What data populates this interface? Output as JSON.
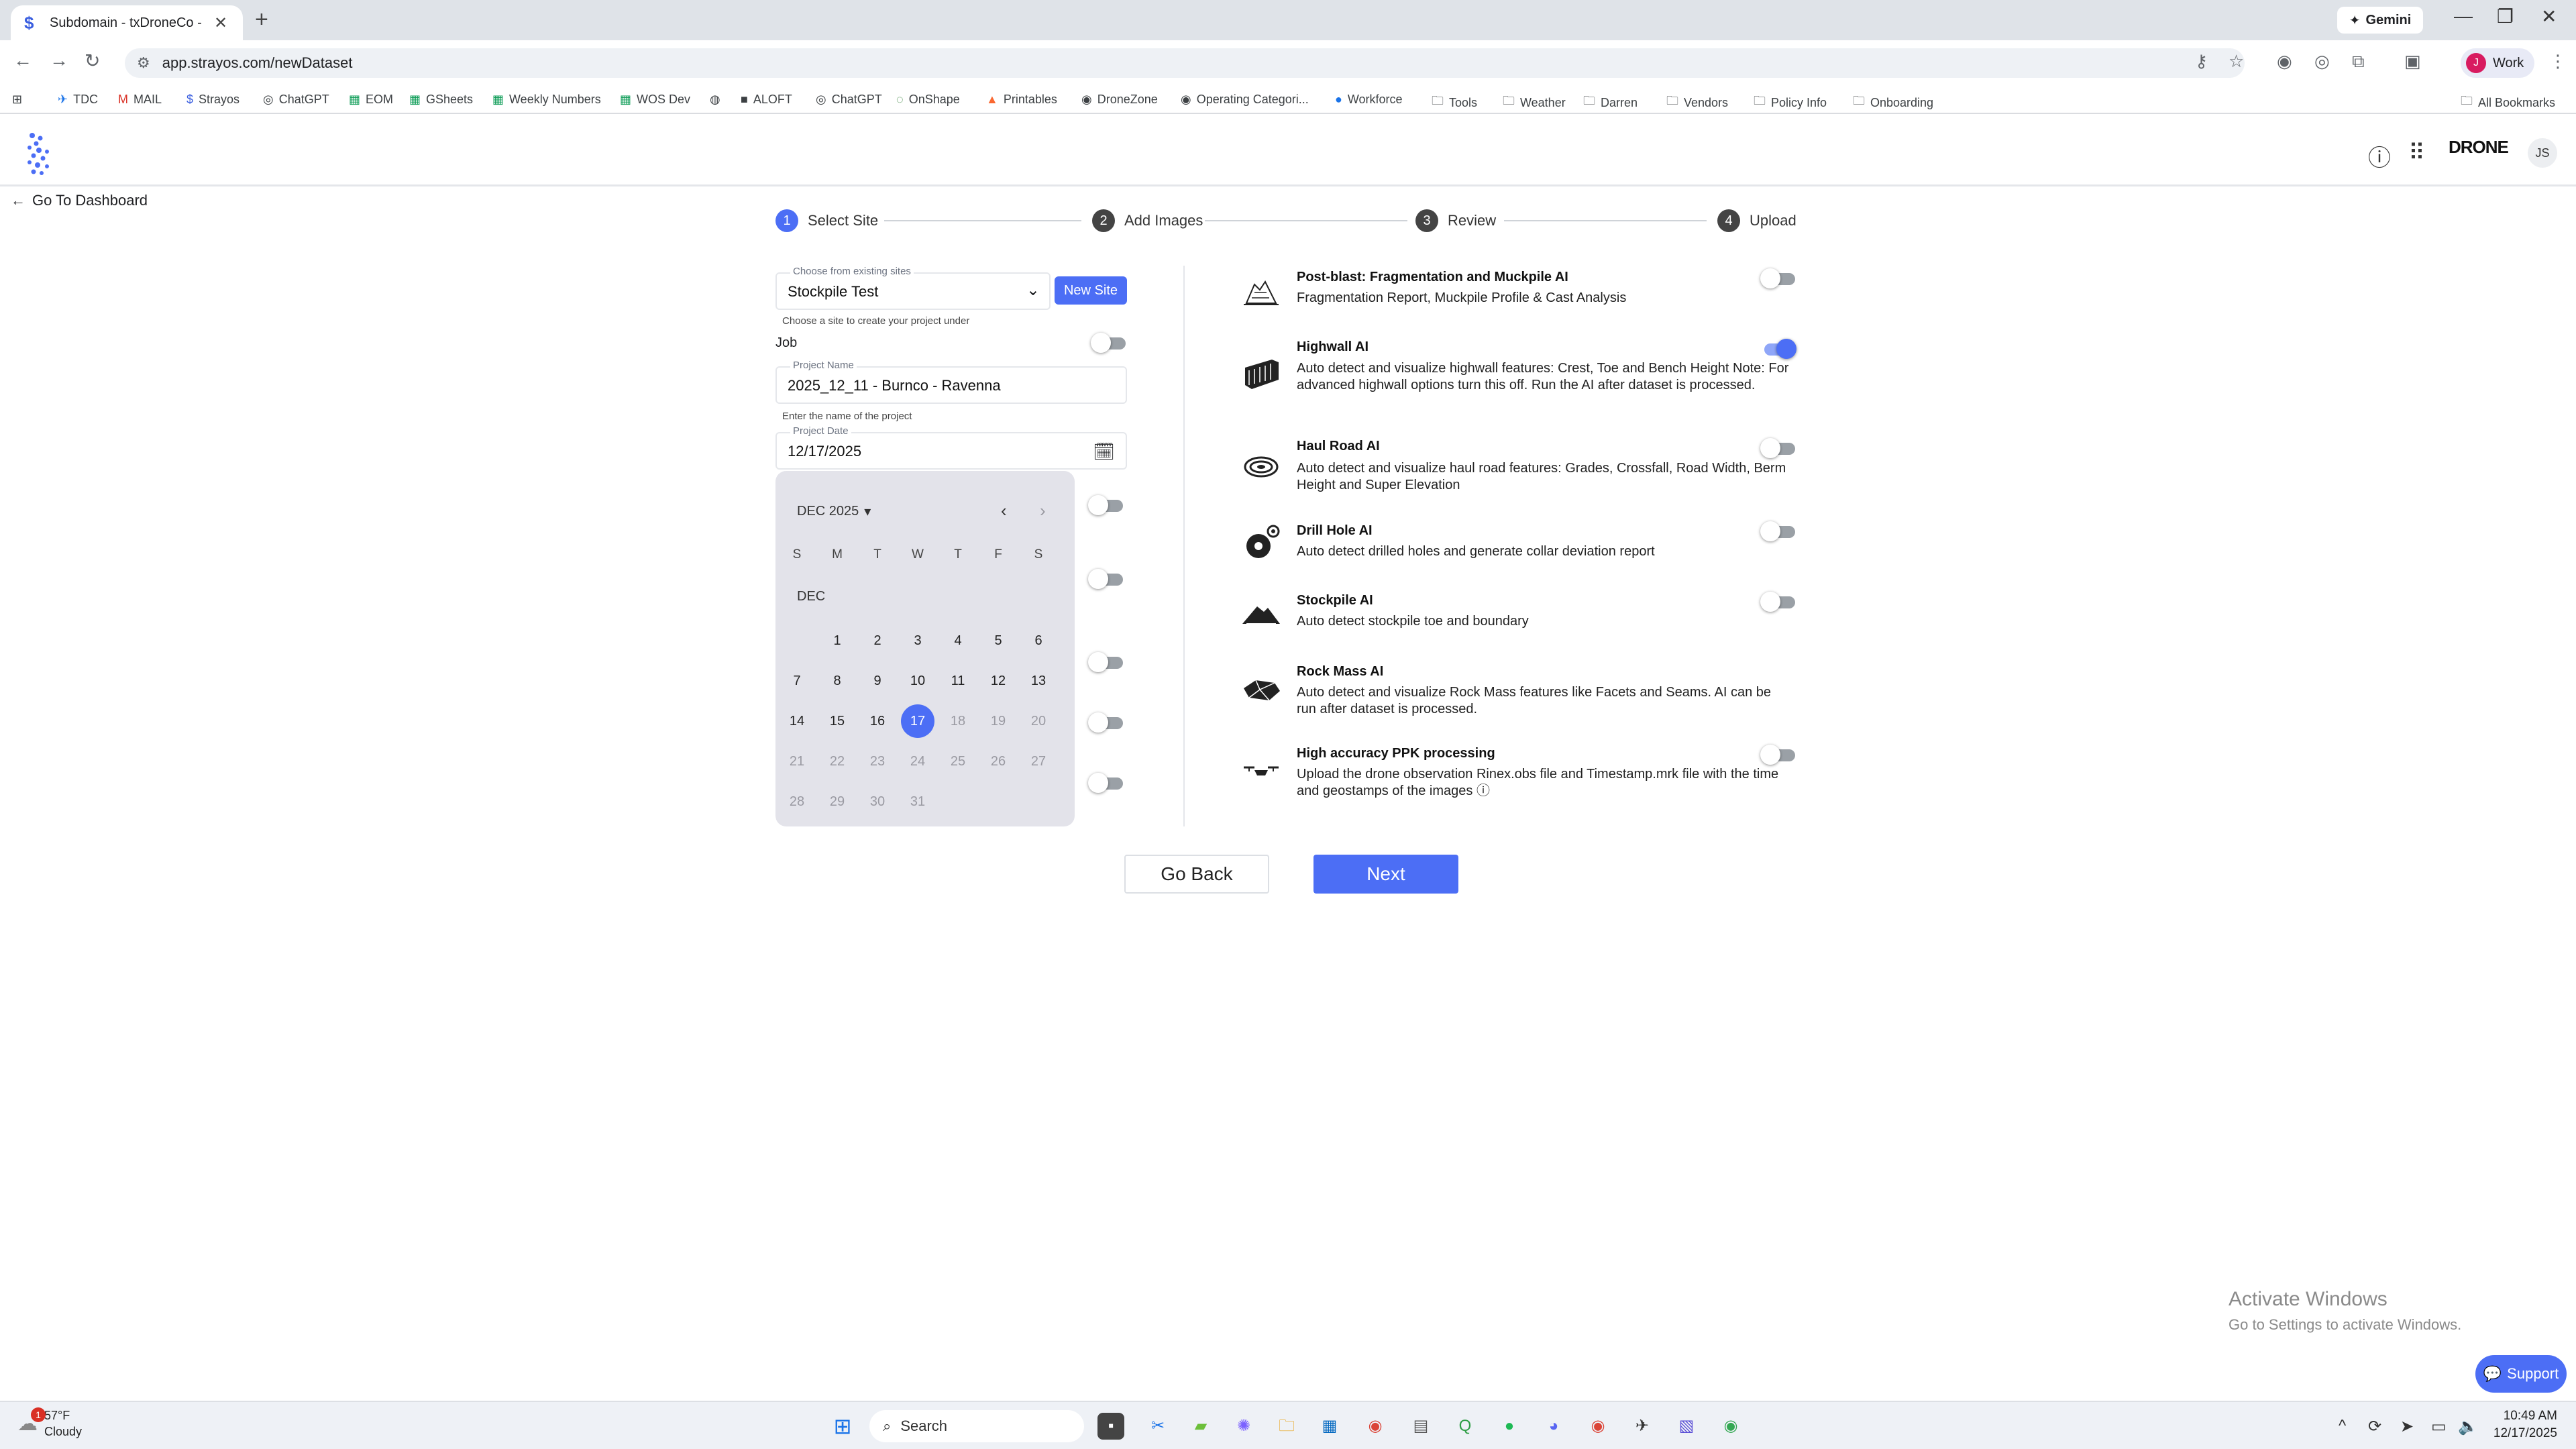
{
  "browser": {
    "tab_title": "Subdomain - txDroneCo - Dem",
    "gemini_label": "Gemini",
    "url": "app.strayos.com/newDataset",
    "profile_label": "Work",
    "profile_initial": "J",
    "bookmarks": [
      {
        "label": "TDC",
        "icon": "tdc-icon"
      },
      {
        "label": "MAIL",
        "icon": "gmail-icon"
      },
      {
        "label": "Strayos",
        "icon": "strayos-icon"
      },
      {
        "label": "ChatGPT",
        "icon": "chatgpt-icon"
      },
      {
        "label": "EOM",
        "icon": "sheets-icon"
      },
      {
        "label": "GSheets",
        "icon": "sheets-icon"
      },
      {
        "label": "Weekly Numbers",
        "icon": "sheets-icon"
      },
      {
        "label": "WOS Dev",
        "icon": "sheets-icon"
      },
      {
        "label": "",
        "icon": "globe-icon"
      },
      {
        "label": "ALOFT",
        "icon": "aloft-icon"
      },
      {
        "label": "ChatGPT",
        "icon": "chatgpt-icon"
      },
      {
        "label": "OnShape",
        "icon": "onshape-icon"
      },
      {
        "label": "Printables",
        "icon": "printables-icon"
      },
      {
        "label": "DroneZone",
        "icon": "dronezone-icon"
      },
      {
        "label": "Operating Categori...",
        "icon": "dronezone-icon"
      },
      {
        "label": "Workforce",
        "icon": "workforce-icon"
      },
      {
        "label": "Tools",
        "icon": "folder-icon"
      },
      {
        "label": "Weather",
        "icon": "folder-icon"
      },
      {
        "label": "Darren",
        "icon": "folder-icon"
      },
      {
        "label": "Vendors",
        "icon": "folder-icon"
      },
      {
        "label": "Policy Info",
        "icon": "folder-icon"
      },
      {
        "label": "Onboarding",
        "icon": "folder-icon"
      }
    ],
    "all_bookmarks": "All Bookmarks"
  },
  "header": {
    "brand_badge": "DRONE",
    "user_initials": "JS"
  },
  "nav": {
    "back_to_dashboard": "Go To Dashboard"
  },
  "stepper": [
    {
      "num": "1",
      "label": "Select Site",
      "active": true
    },
    {
      "num": "2",
      "label": "Add Images",
      "active": false
    },
    {
      "num": "3",
      "label": "Review",
      "active": false
    },
    {
      "num": "4",
      "label": "Upload",
      "active": false
    }
  ],
  "form": {
    "site_label": "Choose from existing sites",
    "site_value": "Stockpile Test",
    "new_site_button": "New Site",
    "site_hint": "Choose a site to create your project under",
    "job_label": "Job",
    "job_toggle_on": false,
    "project_name_label": "Project Name",
    "project_name_value": "2025_12_11 - Burnco - Ravenna",
    "project_name_hint": "Enter the name of the project",
    "project_date_label": "Project Date",
    "project_date_value": "12/17/2025"
  },
  "calendar": {
    "month_label": "DEC 2025",
    "section_label": "DEC",
    "weekdays": [
      "S",
      "M",
      "T",
      "W",
      "T",
      "F",
      "S"
    ],
    "selected_day": "17",
    "weeks": [
      [
        "",
        "1",
        "2",
        "3",
        "4",
        "5",
        "6"
      ],
      [
        "7",
        "8",
        "9",
        "10",
        "11",
        "12",
        "13"
      ],
      [
        "14",
        "15",
        "16",
        "17",
        "18",
        "19",
        "20"
      ],
      [
        "21",
        "22",
        "23",
        "24",
        "25",
        "26",
        "27"
      ],
      [
        "28",
        "29",
        "30",
        "31",
        "",
        "",
        ""
      ]
    ],
    "first_disabled_day": 18
  },
  "ai_features": [
    {
      "title": "Post-blast: Fragmentation and Muckpile AI",
      "desc": "Fragmentation Report, Muckpile Profile & Cast Analysis",
      "enabled": false,
      "icon": "fragmentation-icon"
    },
    {
      "title": "Highwall AI",
      "desc": "Auto detect and visualize highwall features: Crest, Toe and Bench Height Note: For advanced highwall options turn this off. Run the AI after dataset is processed.",
      "enabled": true,
      "icon": "highwall-icon"
    },
    {
      "title": "Haul Road AI",
      "desc": "Auto detect and visualize haul road features: Grades, Crossfall, Road Width, Berm Height and Super Elevation",
      "enabled": false,
      "icon": "haul-road-icon"
    },
    {
      "title": "Drill Hole AI",
      "desc": "Auto detect drilled holes and generate collar deviation report",
      "enabled": false,
      "icon": "drill-hole-icon"
    },
    {
      "title": "Stockpile AI",
      "desc": "Auto detect stockpile toe and boundary",
      "enabled": false,
      "icon": "stockpile-icon"
    },
    {
      "title": "Rock Mass AI",
      "desc": "Auto detect and visualize Rock Mass features like Facets and Seams. AI can be run after dataset is processed.",
      "enabled": false,
      "icon": "rock-mass-icon"
    },
    {
      "title": "High accuracy PPK processing",
      "desc": "Upload the drone observation Rinex.obs file and Timestamp.mrk file with the time and geostamps of the images ⓘ",
      "enabled": false,
      "icon": "drone-icon"
    }
  ],
  "actions": {
    "back": "Go Back",
    "next": "Next"
  },
  "watermark": {
    "line1": "Activate Windows",
    "line2": "Go to Settings to activate Windows."
  },
  "support_label": "Support",
  "taskbar": {
    "temperature": "57°F",
    "condition": "Cloudy",
    "weather_alert_count": "1",
    "search_placeholder": "Search",
    "time": "10:49 AM",
    "date": "12/17/2025"
  },
  "colors": {
    "accent": "#4c6ef5",
    "toggle_off": "#9aa0a6",
    "calendar_bg": "#e3e3ea"
  }
}
